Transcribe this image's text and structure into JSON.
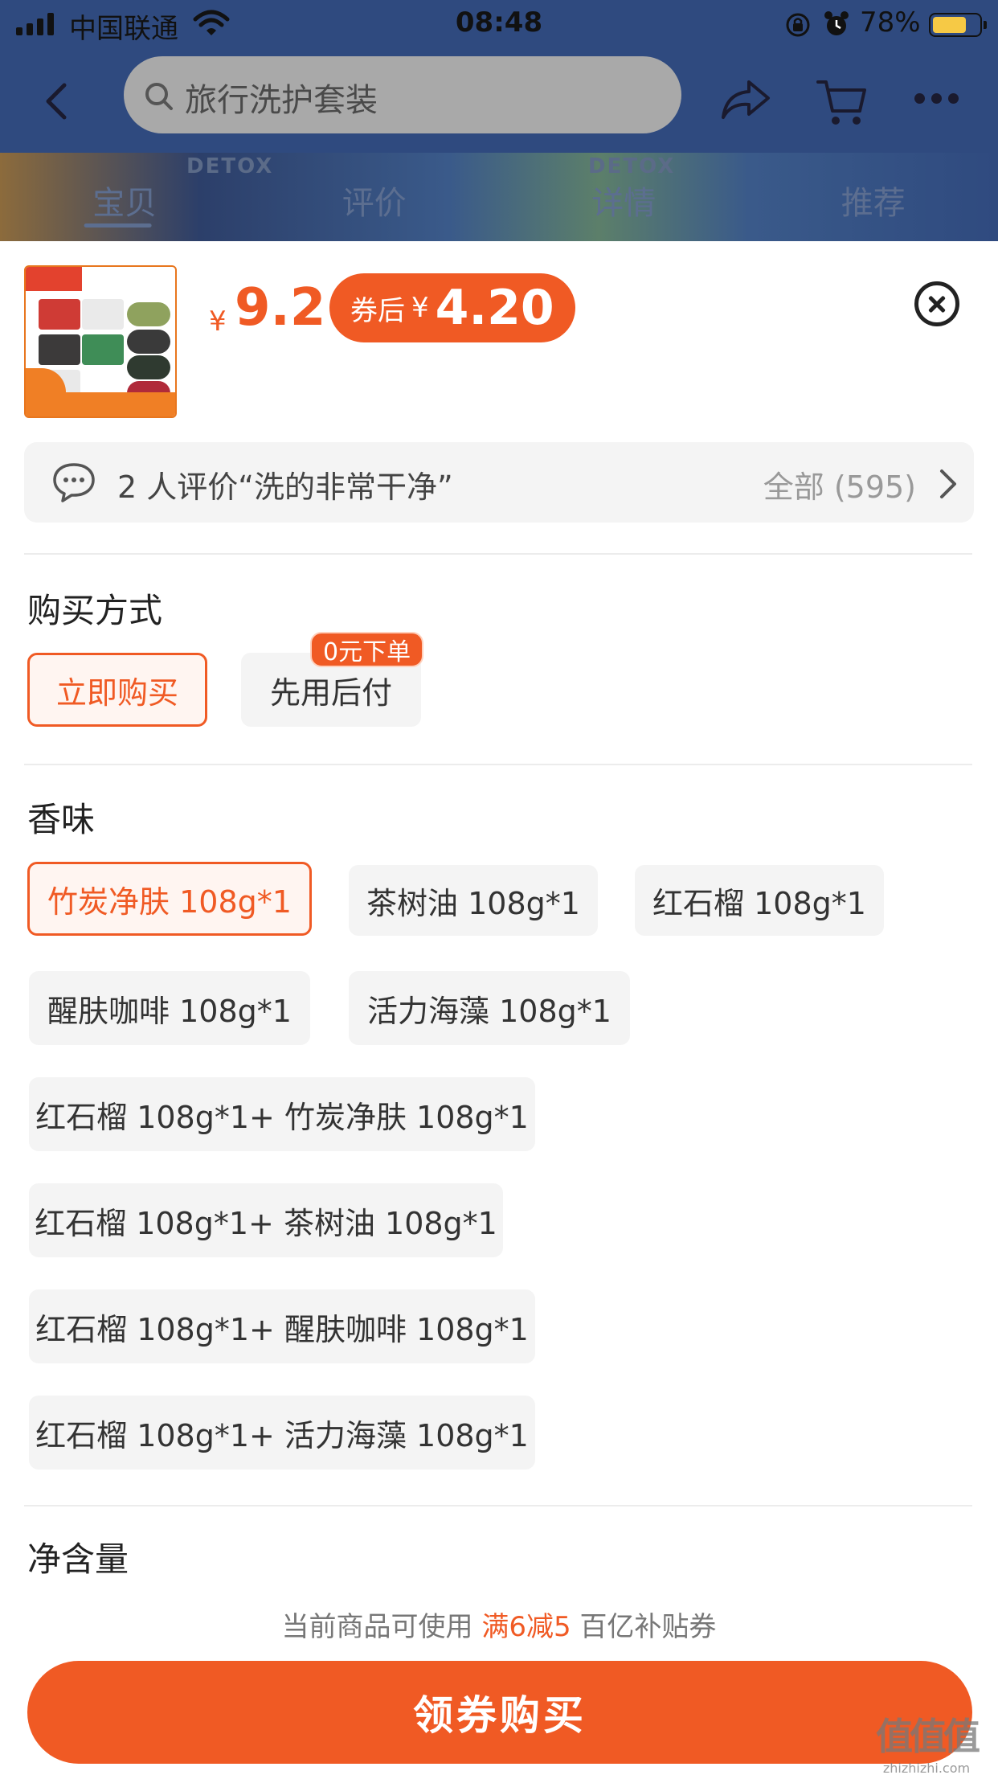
{
  "status_bar": {
    "carrier": "中国联通",
    "time": "08:48",
    "battery_percent": "78%",
    "battery_level": 0.78,
    "battery_color": "#f6c945"
  },
  "nav": {
    "search_text": "旅行洗护套装",
    "icons": [
      "back-arrow-icon",
      "search-icon",
      "share-icon",
      "cart-icon",
      "more-icon"
    ]
  },
  "hero": {
    "brand_text_1": "DETOX",
    "brand_text_2": "DETOX"
  },
  "tabs": [
    {
      "label": "宝贝",
      "active": true
    },
    {
      "label": "评价",
      "active": false
    },
    {
      "label": "详情",
      "active": false
    },
    {
      "label": "推荐",
      "active": false
    }
  ],
  "product": {
    "currency": "¥",
    "price": "9.2",
    "coupon_label": "券后",
    "coupon_currency": "¥",
    "coupon_price": "4.20"
  },
  "review": {
    "summary": "2 人评价“洗的非常干净”",
    "all_label": "全部 (595)"
  },
  "purchase_method": {
    "title": "购买方式",
    "options": [
      {
        "label": "立即购买",
        "selected": true
      },
      {
        "label": "先用后付",
        "selected": false
      }
    ],
    "badge": "0元下单"
  },
  "scent": {
    "title": "香味",
    "options": [
      {
        "label": "竹炭净肤 108g*1",
        "selected": true
      },
      {
        "label": "茶树油 108g*1",
        "selected": false
      },
      {
        "label": "红石榴 108g*1",
        "selected": false
      },
      {
        "label": "醒肤咖啡 108g*1",
        "selected": false
      },
      {
        "label": "活力海藻 108g*1",
        "selected": false
      },
      {
        "label": "红石榴 108g*1+ 竹炭净肤 108g*1",
        "selected": false
      },
      {
        "label": "红石榴 108g*1+ 茶树油 108g*1",
        "selected": false
      },
      {
        "label": "红石榴 108g*1+ 醒肤咖啡 108g*1",
        "selected": false
      },
      {
        "label": "红石榴 108g*1+ 活力海藻 108g*1",
        "selected": false
      }
    ]
  },
  "net_content": {
    "title": "净含量"
  },
  "footer": {
    "hint_prefix": "当前商品可使用",
    "hint_highlight": "满6减5",
    "hint_suffix": "百亿补贴券",
    "buy_button": "领券购买"
  },
  "watermark": {
    "big": "值值值",
    "small": "zhizhizhi.com"
  },
  "colors": {
    "accent": "#f05a24",
    "nav_bg": "#2f4a7f",
    "option_bg": "#f4f4f4"
  }
}
